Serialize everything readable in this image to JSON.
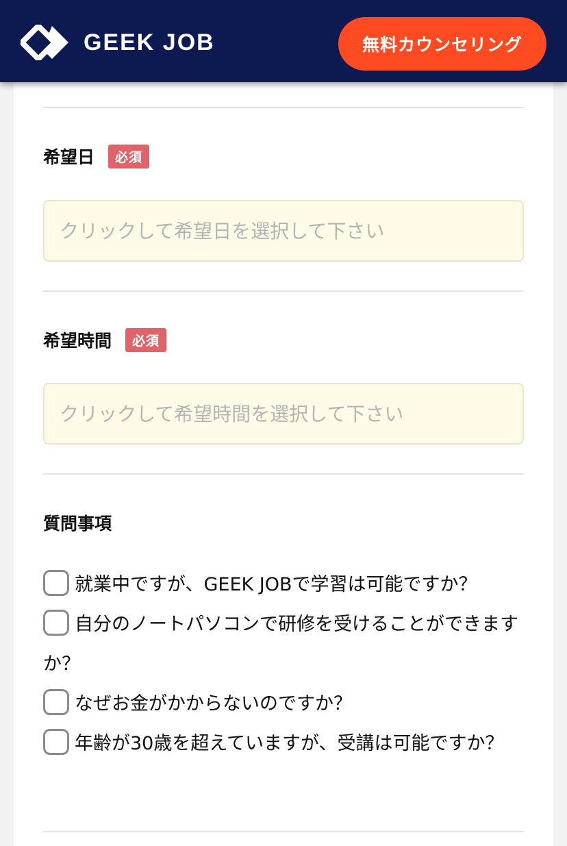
{
  "header": {
    "logo_text": "GEEK JOB",
    "cta_label": "無料カウンセリング",
    "background_color": "#0d1a52",
    "cta_color": "#ff4a22"
  },
  "form": {
    "date_field": {
      "label": "希望日",
      "required_badge": "必須",
      "placeholder": "クリックして希望日を選択して下さい"
    },
    "time_field": {
      "label": "希望時間",
      "required_badge": "必須",
      "placeholder": "クリックして希望時間を選択して下さい"
    },
    "questions": {
      "title": "質問事項",
      "items": [
        {
          "label": "就業中ですが、GEEK JOBで学習は可能ですか？",
          "checked": false
        },
        {
          "label": "自分のノートパソコンで研修を受けることができますか？",
          "checked": false
        },
        {
          "label": "なぜお金がかからないのですか？",
          "checked": false
        },
        {
          "label": "年齢が30歳を超えていますが、受講は可能ですか？",
          "checked": false
        }
      ]
    }
  },
  "colors": {
    "required_badge": "#e0636a",
    "input_background": "#fffbe6"
  }
}
